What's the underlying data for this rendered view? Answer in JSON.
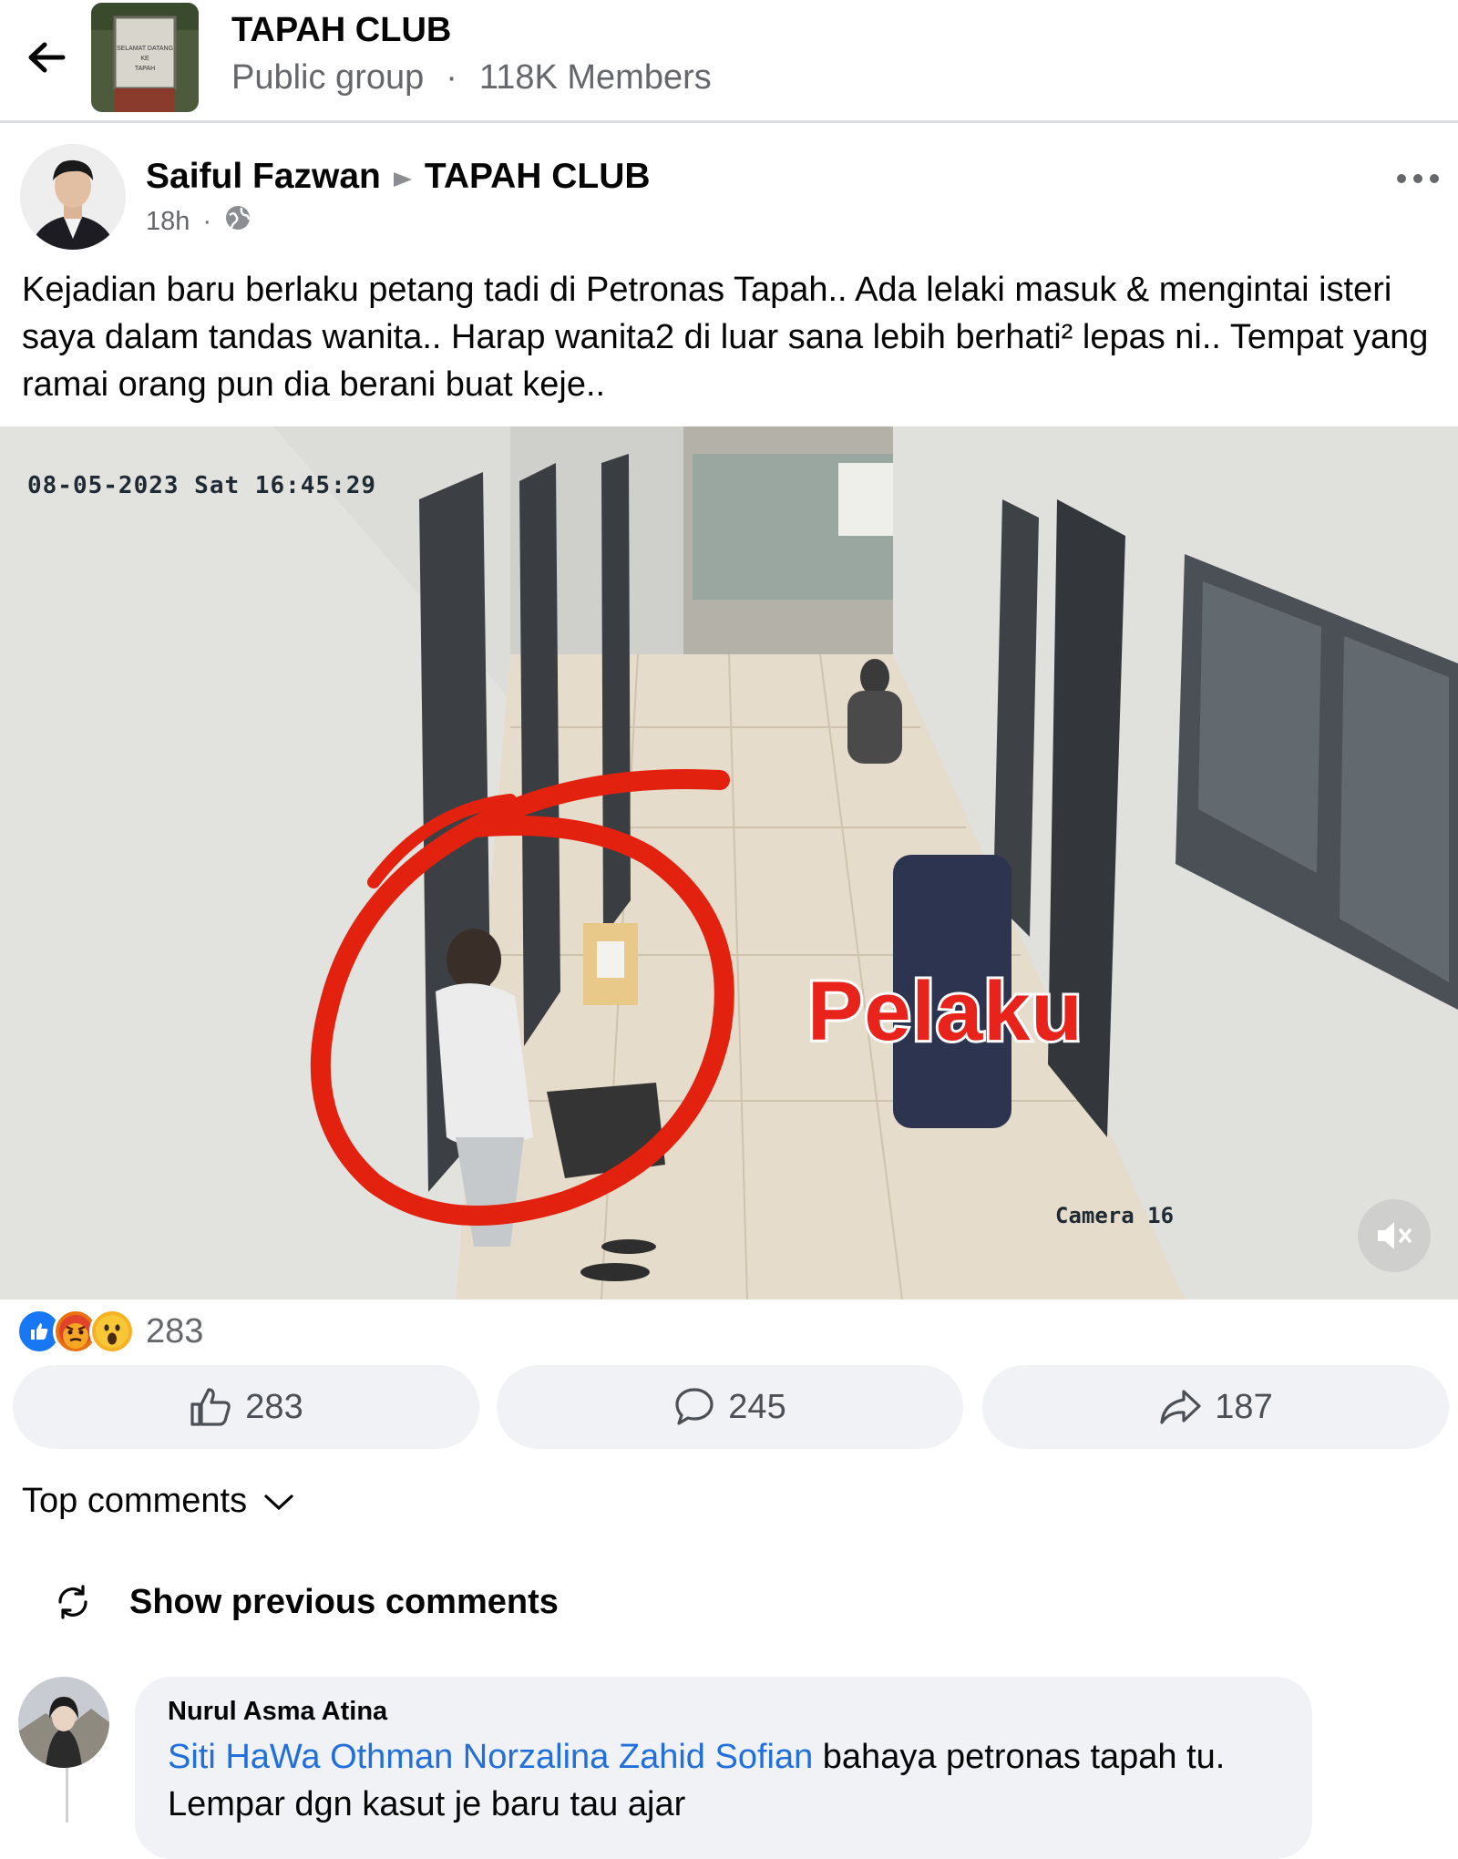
{
  "header": {
    "group_name": "TAPAH CLUB",
    "visibility": "Public group",
    "separator": "·",
    "members": "118K Members",
    "thumb_sign_text": [
      "SELAMAT DATANG",
      "KE",
      "TAPAH"
    ]
  },
  "post": {
    "author": "Saiful Fazwan",
    "group": "TAPAH CLUB",
    "time": "18h",
    "separator": "·",
    "audience_icon": "globe-icon",
    "text": "Kejadian baru berlaku petang tadi di Petronas Tapah.. Ada lelaki masuk & mengintai isteri saya dalam tandas wanita.. Harap wanita2 di luar sana lebih berhati² lepas ni.. Tempat yang ramai orang pun dia berani buat keje.."
  },
  "media": {
    "timestamp": "08-05-2023 Sat 16:45:29",
    "camera_label": "Camera 16",
    "overlay_text": "Pelaku",
    "mute_icon": "muted-speaker-icon"
  },
  "reactions": {
    "types": [
      "like",
      "angry",
      "wow"
    ],
    "count": "283"
  },
  "actions": {
    "like_count": "283",
    "comment_count": "245",
    "share_count": "187"
  },
  "comments_section": {
    "sort_label": "Top comments",
    "show_previous": "Show previous comments"
  },
  "comment": {
    "author": "Nurul Asma Atina",
    "mentions": "Siti HaWa Othman Norzalina Zahid Sofian",
    "text": " bahaya petronas tapah tu. Lempar dgn kasut je baru tau ajar"
  },
  "colors": {
    "link": "#216fdb",
    "secondary_text": "#65676b",
    "button_bg": "#f0f2f5",
    "overlay_red": "#e8231b"
  }
}
